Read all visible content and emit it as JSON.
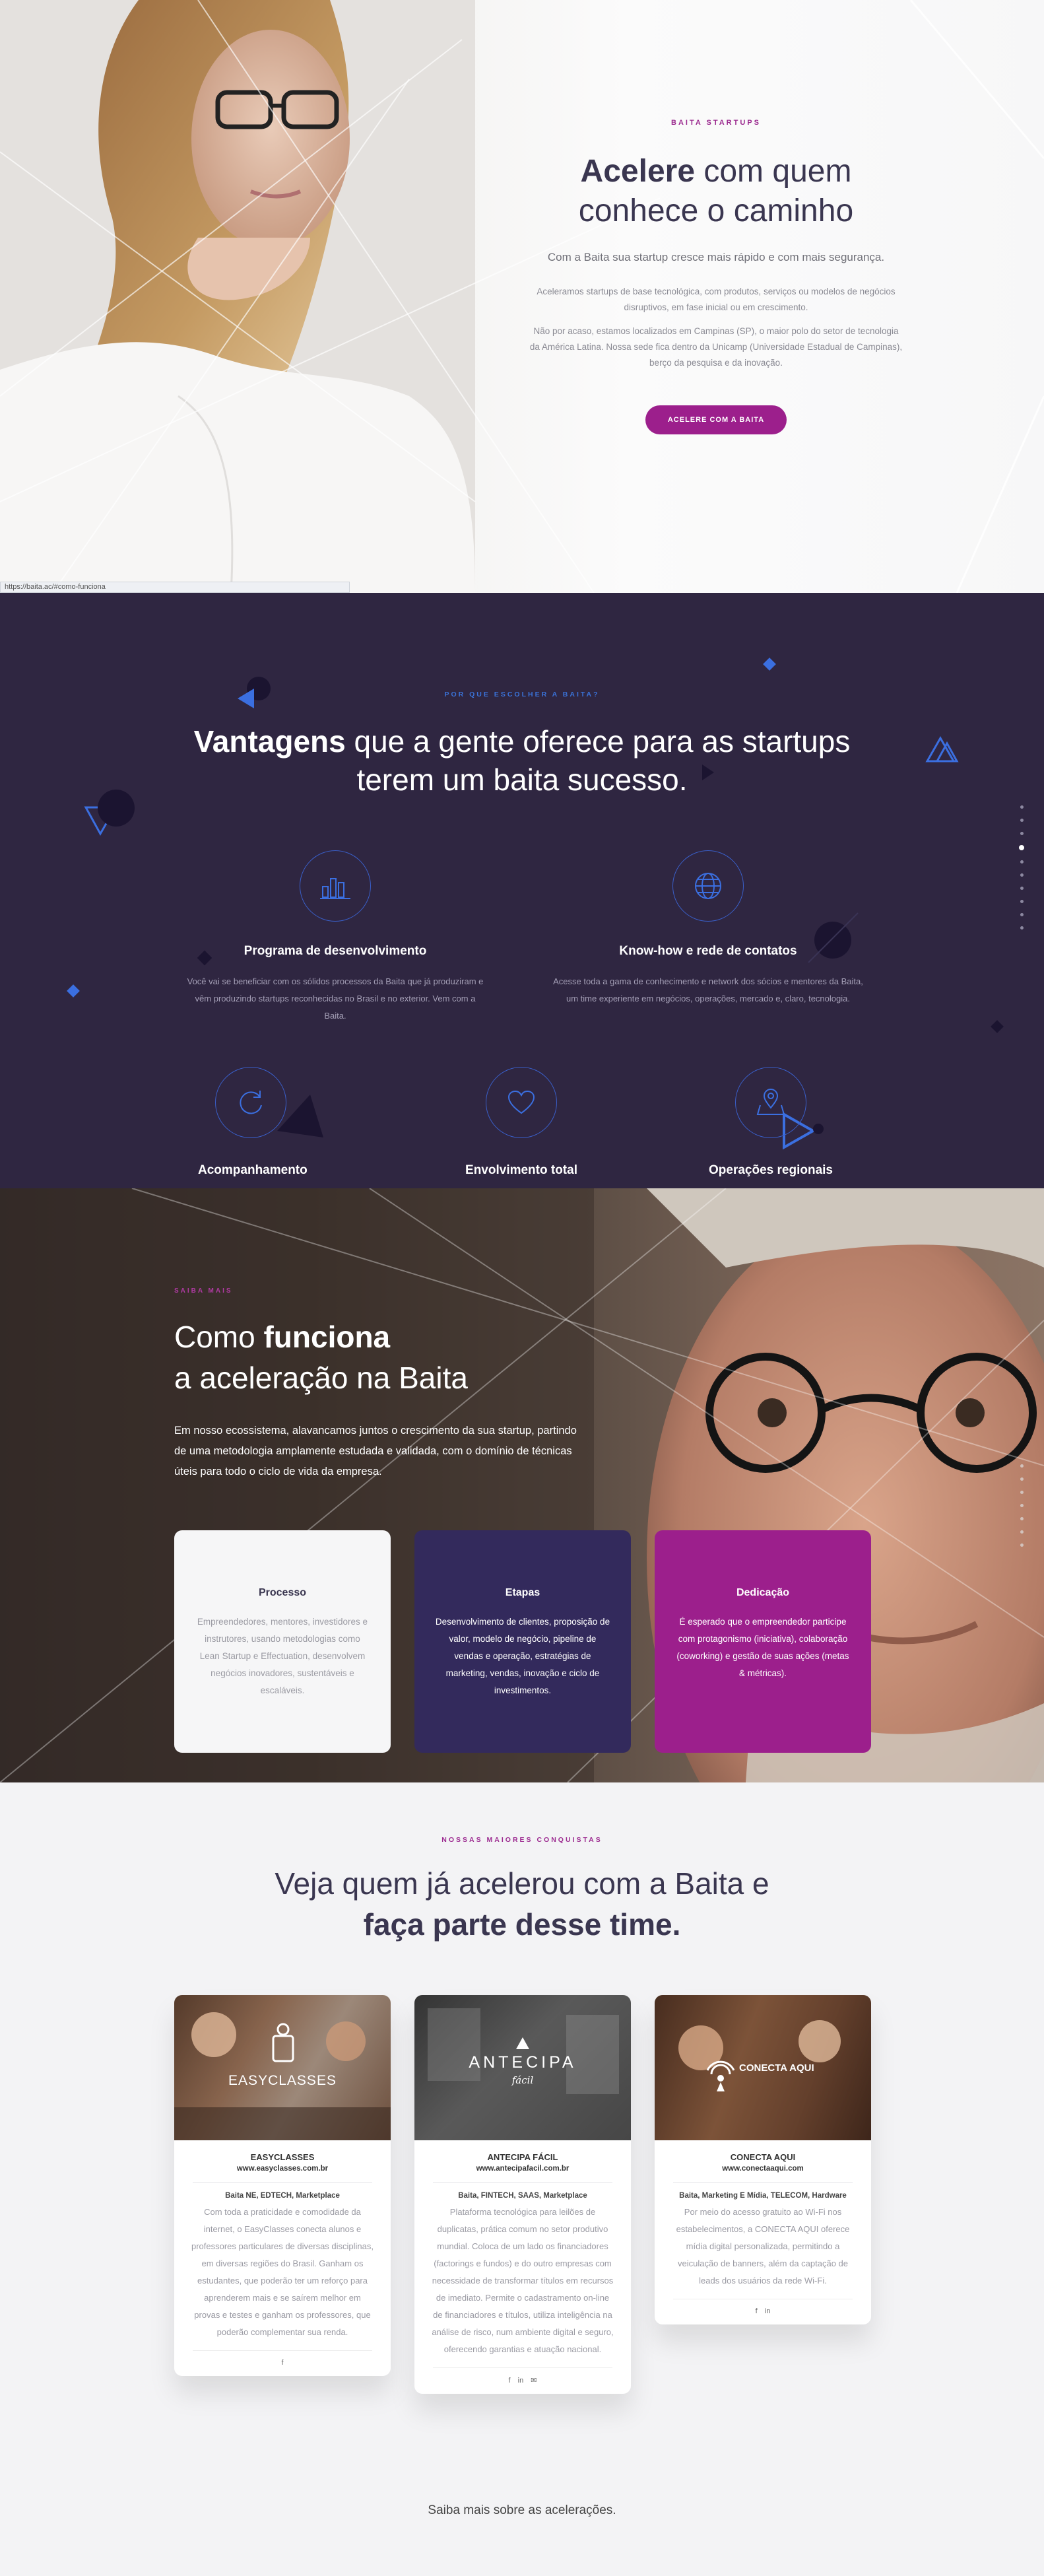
{
  "status_bar": {
    "url": "https://baita.ac/#como-funciona"
  },
  "hero": {
    "eyebrow": "BAITA STARTUPS",
    "title_bold": "Acelere",
    "title_rest": " com quem",
    "title_line2": "conhece o caminho",
    "lead": "Com a Baita sua startup cresce mais rápido e com mais segurança.",
    "paragraph1": "Aceleramos startups de base tecnológica, com produtos, serviços ou modelos de negócios disruptivos, em fase inicial ou em crescimento.",
    "paragraph2": "Não por acaso, estamos localizados em Campinas (SP), o maior polo do setor de tecnologia da América Latina. Nossa sede fica dentro da Unicamp (Universidade Estadual de Campinas), berço da pesquisa e da inovação.",
    "cta_label": "ACELERE COM A BAITA"
  },
  "advantages": {
    "eyebrow": "POR QUE ESCOLHER A BAITA?",
    "title_bold": "Vantagens",
    "title_rest": " que a gente oferece para as startups",
    "title_line2": "terem um baita sucesso.",
    "features": [
      {
        "title": "Programa de desenvolvimento",
        "icon": "chart-icon",
        "desc": "Você vai se beneficiar com os sólidos processos da Baita que já produziram e vêm produzindo startups reconhecidas no Brasil e no exterior. Vem com a Baita."
      },
      {
        "title": "Know-how e rede de contatos",
        "icon": "globe-icon",
        "desc": "Acesse toda a gama de conhecimento e network dos sócios e mentores da Baita, um time experiente em negócios, operações, mercado e, claro, tecnologia."
      },
      {
        "title": "Acompanhamento",
        "icon": "refresh-icon"
      },
      {
        "title": "Envolvimento total",
        "icon": "heart-icon"
      },
      {
        "title": "Operações regionais",
        "icon": "map-pin-icon"
      }
    ],
    "colors": {
      "background": "#2f2641",
      "accent": "#3a5fc9"
    }
  },
  "how": {
    "eyebrow": "SAIBA MAIS",
    "title_line1_pre": "Como ",
    "title_line1_bold": "funciona",
    "title_line2": "a aceleração na Baita",
    "paragraph": "Em nosso ecossistema, alavancamos juntos o crescimento da sua startup, partindo de uma metodologia amplamente estudada e validada, com o domínio de técnicas úteis para todo o ciclo de vida da empresa.",
    "cards": [
      {
        "title": "Processo",
        "desc": "Empreendedores, mentores, investidores e instrutores, usando metodologias como Lean Startup e Effectuation, desenvolvem negócios inovadores, sustentáveis e escaláveis."
      },
      {
        "title": "Etapas",
        "desc": "Desenvolvimento de clientes, proposição de valor, modelo de negócio, pipeline de vendas e operação, estratégias de marketing, vendas, inovação e ciclo de investimentos."
      },
      {
        "title": "Dedicação",
        "desc": "É esperado que o empreendedor participe com protagonismo (iniciativa), colaboração (coworking) e gestão de suas ações (metas & métricas)."
      }
    ]
  },
  "portfolio": {
    "eyebrow": "NOSSAS MAIORES CONQUISTAS",
    "title_line1": "Veja quem já acelerou com a Baita e",
    "title_line2": "faça parte desse time.",
    "startups": [
      {
        "logo_text": "EASYCLASSES",
        "name": "EASYCLASSES",
        "url": "www.easyclasses.com.br",
        "tags": "Baita NE, EDTECH, Marketplace",
        "desc": "Com toda a praticidade e comodidade da internet, o EasyClasses conecta alunos e professores particulares de diversas disciplinas, em diversas regiões do Brasil. Ganham os estudantes, que poderão ter um reforço para aprenderem mais e se saírem melhor em provas e testes e ganham os professores, que poderão complementar sua renda.",
        "social": [
          "f"
        ]
      },
      {
        "logo_text": "ANTECIPA",
        "logo_sub": "fácil",
        "name": "ANTECIPA FÁCIL",
        "url": "www.antecipafacil.com.br",
        "tags": "Baita, FINTECH, SAAS, Marketplace",
        "desc": "Plataforma tecnológica para leilões de duplicatas, prática comum no setor produtivo mundial. Coloca de um lado os financiadores (factorings e fundos) e do outro empresas com necessidade de transformar títulos em recursos de imediato. Permite o cadastramento on-line de financiadores e títulos, utiliza inteligência na análise de risco, num ambiente digital e seguro, oferecendo garantias e atuação nacional.",
        "social": [
          "f",
          "in",
          "✉"
        ]
      },
      {
        "logo_text": "CONECTA AQUI",
        "name": "CONECTA AQUI",
        "url": "www.conectaaqui.com",
        "tags": "Baita, Marketing E Mídia, TELECOM, Hardware",
        "desc": "Por meio do acesso gratuito ao Wi-Fi nos estabelecimentos, a CONECTA AQUI oferece mídia digital personalizada, permitindo a veiculação de banners, além da captação de leads dos usuários da rede Wi-Fi.",
        "social": [
          "f",
          "in"
        ]
      }
    ],
    "more_link": "Saiba mais sobre as acelerações."
  }
}
